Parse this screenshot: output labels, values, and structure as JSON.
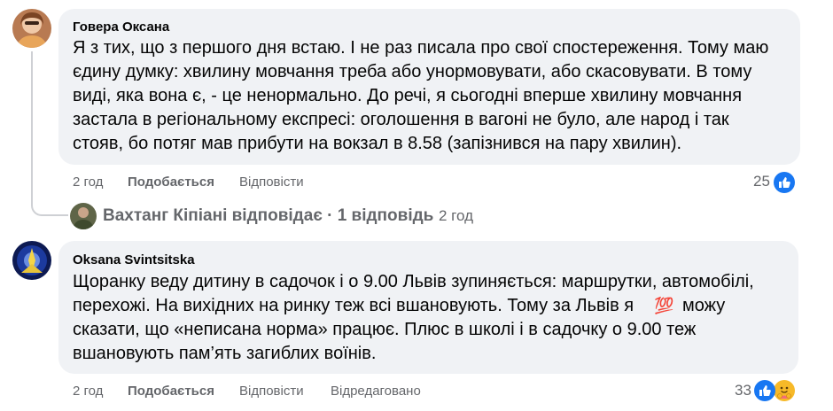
{
  "comments": [
    {
      "author": "Говера Оксана",
      "lines": [
        "Я з тих, що з першого дня встаю. І не раз писала про свої спостереження. Тому маю",
        "єдину думку: хвилину мовчання треба або унормовувати, або скасовувати. В тому",
        "виді, яка вона є, - це ненормально. До речі, я сьогодні вперше хвилину мовчання",
        "застала в регіональному експресі: оголошення в вагоні не було, але народ і так",
        "стояв, бо потяг мав прибути на вокзал в 8.58 (запізнився на пару хвилин)."
      ],
      "time": "2 год",
      "like_label": "Подобається",
      "reply_label": "Відповісти",
      "reaction_count": "25",
      "reply_summary": {
        "text": "Вахтанг Кіпіані відповідає · 1 відповідь",
        "time": "2 год"
      }
    },
    {
      "author": "Oksana Svintsitska",
      "lines": [
        "Щоранку веду дитину в садочок і о 9.00 Львів зупиняється: маршрутки, автомобілі,",
        "перехожі. На вихідних на ринку теж всі вшановують. Тому за Львів я",
        "можу",
        "сказати, що «неписана норма» працює. Плюс в школі і в садочку о 9.00 теж",
        "вшановують пам’ять загиблих воїнів."
      ],
      "emoji": "💯",
      "time": "2 год",
      "like_label": "Подобається",
      "reply_label": "Відповісти",
      "edited_label": "Відредаговано",
      "reaction_count": "33"
    }
  ],
  "colors": {
    "bubble": "#f0f2f5",
    "meta": "#65676b",
    "like_blue": "#1877f2",
    "care_yellow": "#f7b928"
  },
  "icons": {
    "like": "thumbs-up-icon",
    "care": "care-hug-icon"
  }
}
